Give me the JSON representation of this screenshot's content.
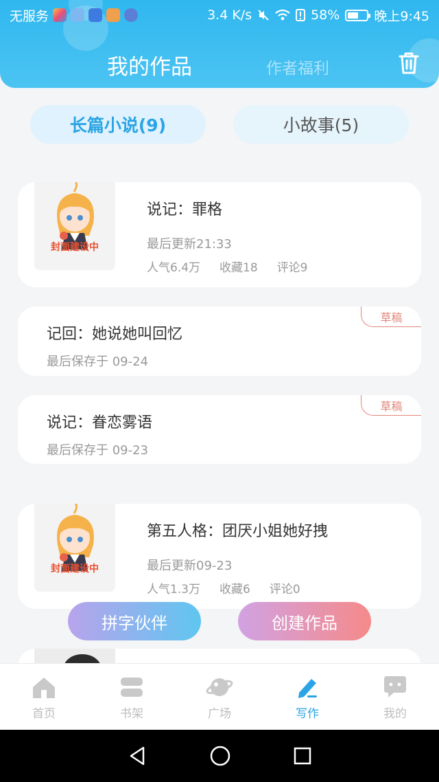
{
  "status_bar": {
    "carrier": "无服务",
    "net_speed": "3.4 K/s",
    "battery": "58%",
    "battery_level": 0.58,
    "time": "晚上9:45"
  },
  "header": {
    "active_tab": "我的作品",
    "other_tab": "作者福利",
    "trash_icon": "trash-icon"
  },
  "segments": {
    "long": "长篇小说(9)",
    "short": "小故事(5)"
  },
  "books": [
    {
      "cover_label": "封面建设中",
      "title": "说记：罪格",
      "updated": "最后更新21:33",
      "popularity": "人气6.4万",
      "favorites": "收藏18",
      "comments": "评论9"
    },
    {
      "title": "记回：她说她叫回忆",
      "saved": "最后保存于 09-24",
      "badge": "草稿"
    },
    {
      "title": "说记：眷恋雾语",
      "saved": "最后保存于 09-23",
      "badge": "草稿"
    },
    {
      "cover_label": "封面建设中",
      "title": "第五人格：团厌小姐她好拽",
      "updated": "最后更新09-23",
      "popularity": "人气1.3万",
      "favorites": "收藏6",
      "comments": "评论0"
    }
  ],
  "actions": {
    "partner": "拼字伙伴",
    "create": "创建作品"
  },
  "bottom_nav": [
    {
      "label": "首页",
      "icon": "home-icon"
    },
    {
      "label": "书架",
      "icon": "bookshelf-icon"
    },
    {
      "label": "广场",
      "icon": "planet-icon"
    },
    {
      "label": "写作",
      "icon": "pen-icon",
      "active": true
    },
    {
      "label": "我的",
      "icon": "chat-bubble-icon"
    }
  ],
  "colors": {
    "header": "#2fb7ef",
    "accent": "#2aa4e4",
    "draft": "#e2867a"
  }
}
